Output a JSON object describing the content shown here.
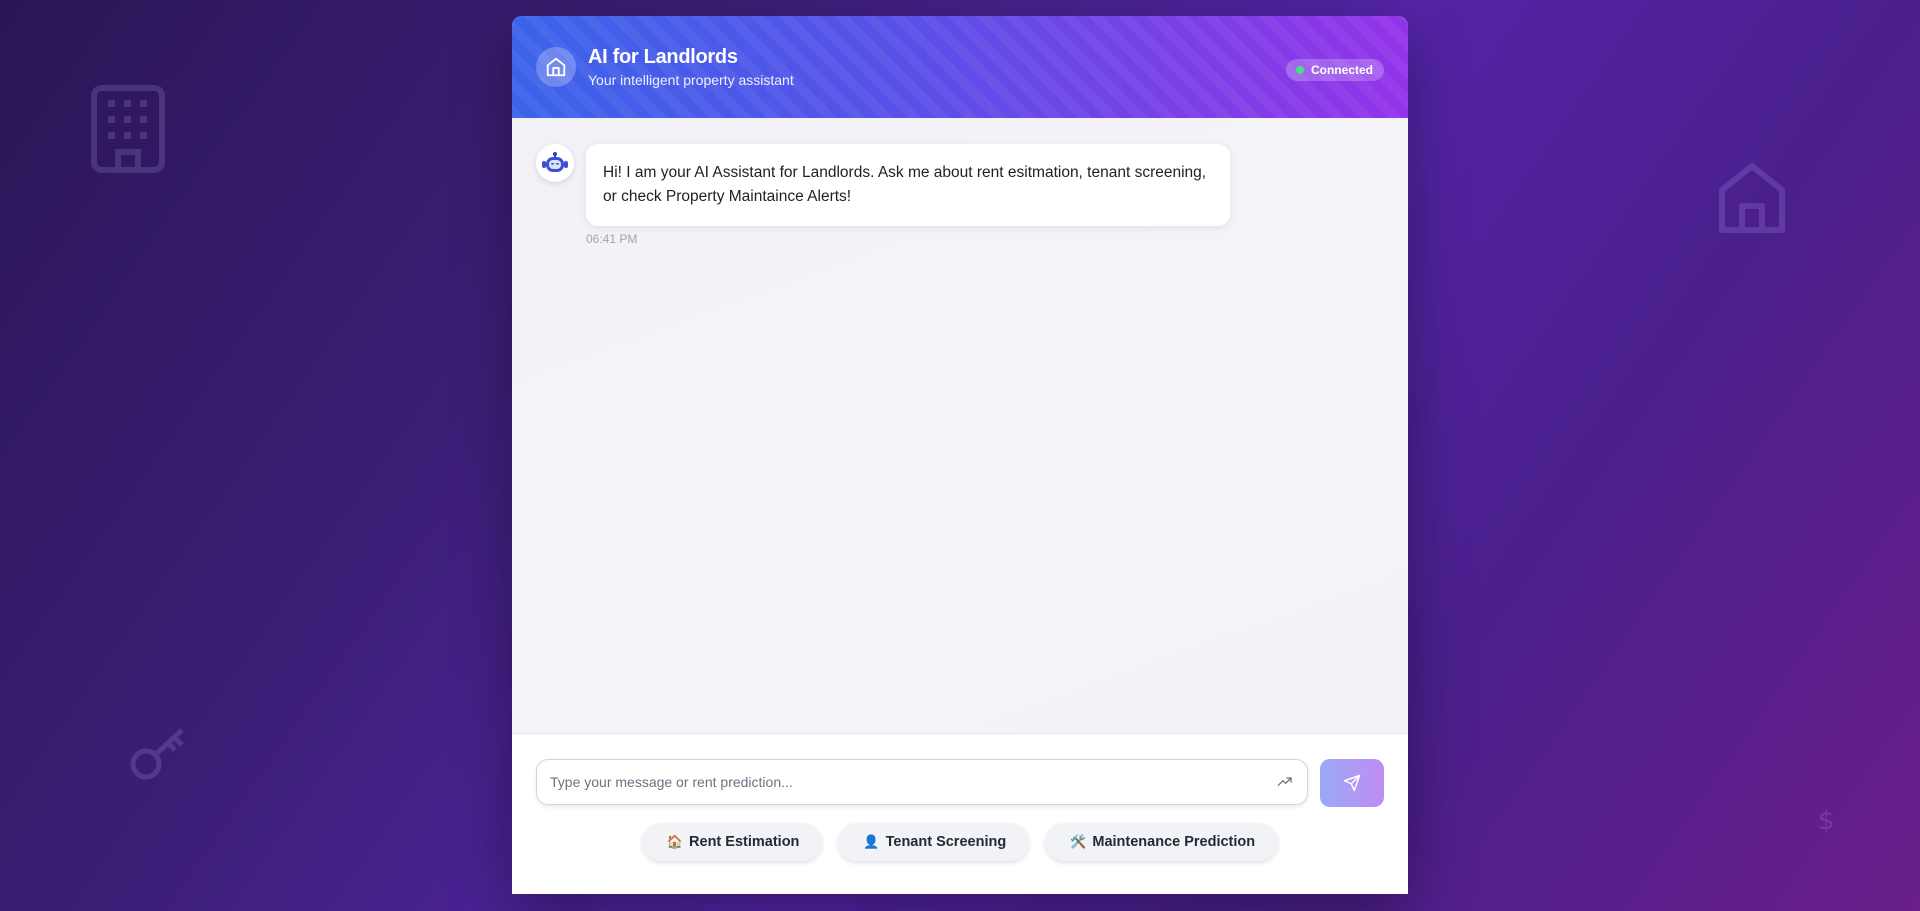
{
  "header": {
    "title": "AI for Landlords",
    "subtitle": "Your intelligent property assistant",
    "status": "Connected"
  },
  "messages": [
    {
      "sender": "bot",
      "text": "Hi! I am your AI Assistant for Landlords. Ask me about rent esitmation, tenant screening, or check Property Maintaince Alerts!",
      "time": "06:41 PM"
    }
  ],
  "composer": {
    "placeholder": "Type your message or rent prediction..."
  },
  "quick_actions": [
    {
      "emoji": "🏠",
      "label": "Rent Estimation"
    },
    {
      "emoji": "👤",
      "label": "Tenant Screening"
    },
    {
      "emoji": "🛠️",
      "label": "Maintenance Prediction"
    }
  ],
  "colors": {
    "accent_start": "#3b63ea",
    "accent_end": "#9333ea",
    "status_dot": "#4ade80"
  }
}
